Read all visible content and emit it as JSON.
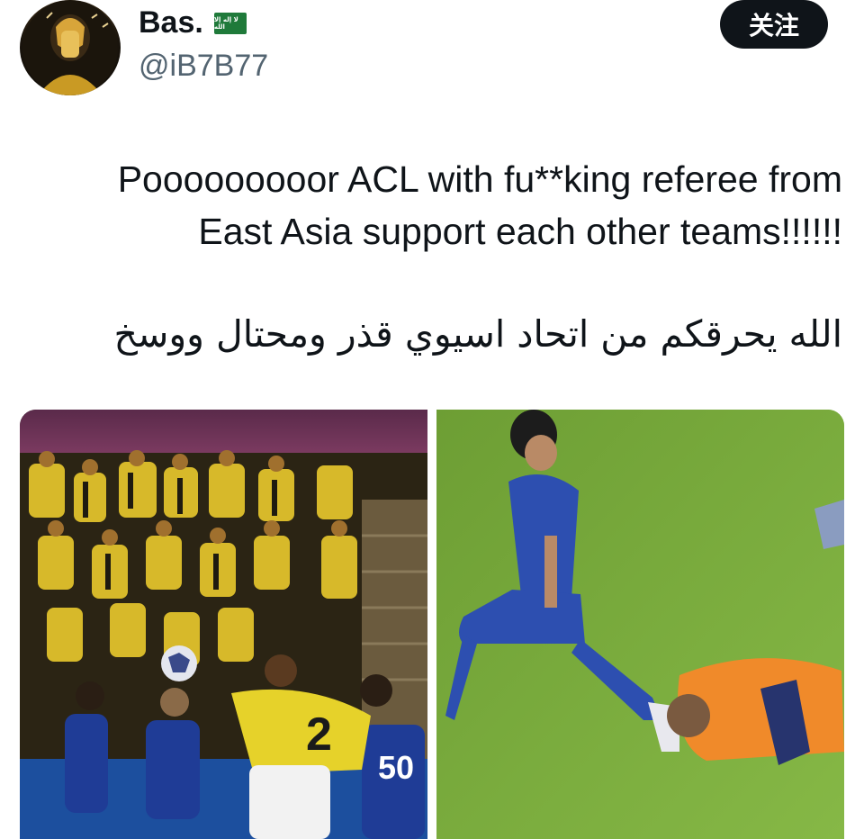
{
  "user": {
    "display_name": "Bas.",
    "flag_text": "ﻻ إله إلا الله",
    "handle": "@iB7B77",
    "follow_label": "关注"
  },
  "tweet": {
    "text_line1": "Pooooooooor ACL with fu**king referee from",
    "text_line2": "East Asia support each other teams!!!!!!",
    "text_arabic": "الله يحرقكم من اتحاد اسيوي قذر ومحتال ووسخ"
  },
  "media": {
    "left_image": {
      "player_number": "2",
      "number_right": "50"
    }
  }
}
